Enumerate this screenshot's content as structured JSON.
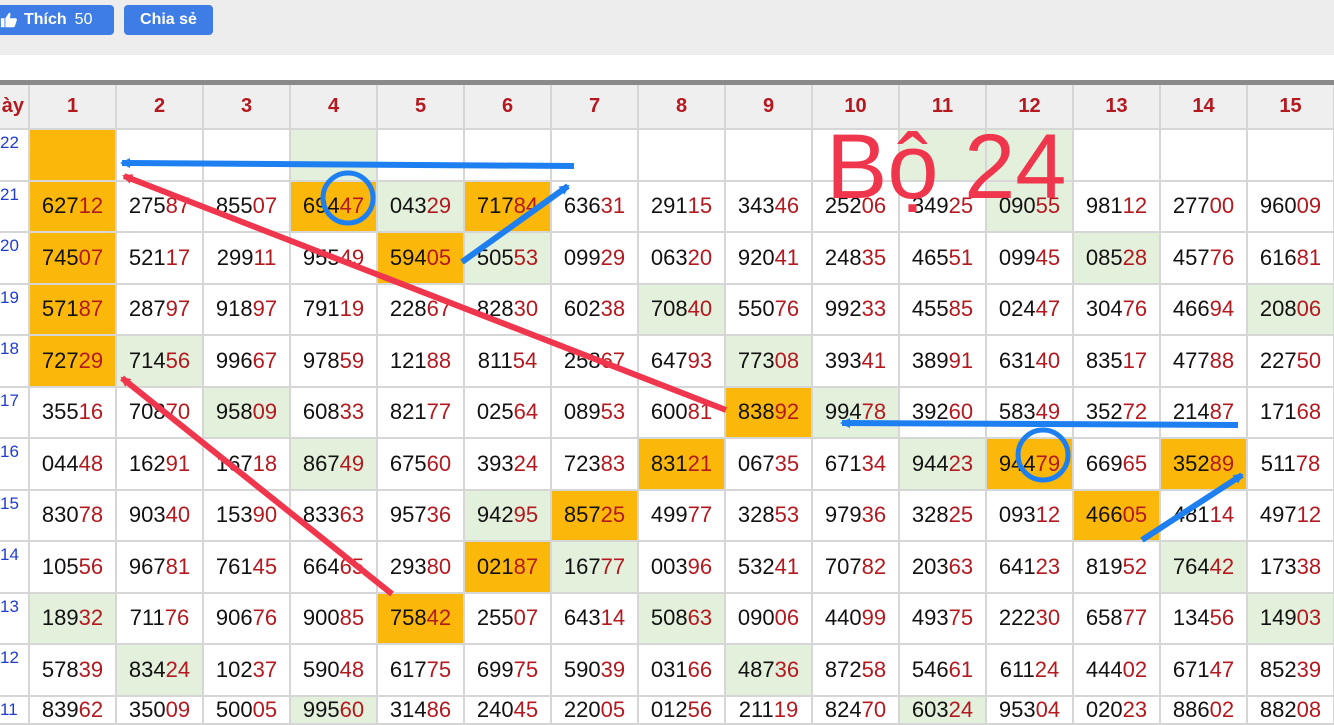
{
  "toolbar": {
    "like_label": "Thích",
    "like_count": "50",
    "share_label": "Chia sẻ"
  },
  "annotation": {
    "text": "Bộ 24"
  },
  "colors": {
    "orange": "#fbb80a",
    "green": "#e3f0dc",
    "red_digits": "#b3191f",
    "arrow_red": "#f0364d",
    "arrow_blue": "#1e7ff0"
  },
  "table": {
    "columns": [
      "ày",
      "1",
      "2",
      "3",
      "4",
      "5",
      "6",
      "7",
      "8",
      "9",
      "10",
      "11",
      "12",
      "13",
      "14",
      "15"
    ],
    "rows": [
      {
        "day": "22",
        "cells": [
          "",
          "",
          "",
          "",
          "",
          "",
          "",
          "",
          "",
          "",
          "",
          "",
          "",
          "",
          ""
        ],
        "hl": [
          "o",
          "",
          "",
          "g",
          "",
          "",
          "",
          "",
          "",
          "",
          "g",
          "g",
          "",
          "",
          ""
        ]
      },
      {
        "day": "21",
        "cells": [
          "62712",
          "27587",
          "85507",
          "69447",
          "04329",
          "71784",
          "63631",
          "29115",
          "34346",
          "25206",
          "34925",
          "09055",
          "98112",
          "27700",
          "96009"
        ],
        "hl": [
          "o",
          "",
          "",
          "o",
          "g",
          "o",
          "",
          "",
          "",
          "",
          "",
          "g",
          "",
          "",
          ""
        ]
      },
      {
        "day": "20",
        "cells": [
          "74507",
          "52117",
          "29911",
          "95549",
          "59405",
          "50553",
          "09929",
          "06320",
          "92041",
          "24835",
          "46551",
          "09945",
          "08528",
          "45776",
          "61681"
        ],
        "hl": [
          "o",
          "",
          "",
          "",
          "o",
          "g",
          "",
          "",
          "",
          "",
          "",
          "",
          "g",
          "",
          ""
        ]
      },
      {
        "day": "19",
        "cells": [
          "57187",
          "28797",
          "91897",
          "79119",
          "22867",
          "82830",
          "60238",
          "70840",
          "55076",
          "99233",
          "45585",
          "02447",
          "30476",
          "46694",
          "20806"
        ],
        "hl": [
          "o",
          "",
          "",
          "",
          "",
          "",
          "",
          "g",
          "",
          "",
          "",
          "",
          "",
          "",
          "g"
        ]
      },
      {
        "day": "18",
        "cells": [
          "72729",
          "71456",
          "99667",
          "97859",
          "12188",
          "81154",
          "25867",
          "64793",
          "77308",
          "39341",
          "38991",
          "63140",
          "83517",
          "47788",
          "22750"
        ],
        "hl": [
          "o",
          "g",
          "",
          "",
          "",
          "",
          "",
          "",
          "g",
          "",
          "",
          "",
          "",
          "",
          ""
        ]
      },
      {
        "day": "17",
        "cells": [
          "35516",
          "70870",
          "95809",
          "60833",
          "82177",
          "02564",
          "08953",
          "60081",
          "83892",
          "99478",
          "39260",
          "58349",
          "35272",
          "21487",
          "17168"
        ],
        "hl": [
          "",
          "",
          "g",
          "",
          "",
          "",
          "",
          "",
          "o",
          "g",
          "",
          "",
          "",
          "",
          ""
        ]
      },
      {
        "day": "16",
        "cells": [
          "04448",
          "16291",
          "16718",
          "86749",
          "67560",
          "39324",
          "72383",
          "83121",
          "06735",
          "67134",
          "94423",
          "94479",
          "66965",
          "35289",
          "51178"
        ],
        "hl": [
          "",
          "",
          "",
          "g",
          "",
          "",
          "",
          "o",
          "",
          "",
          "g",
          "o",
          "",
          "o",
          ""
        ]
      },
      {
        "day": "15",
        "cells": [
          "83078",
          "90340",
          "15390",
          "83363",
          "95736",
          "94295",
          "85725",
          "49977",
          "32853",
          "97936",
          "32825",
          "09312",
          "46605",
          "48114",
          "49712"
        ],
        "hl": [
          "",
          "",
          "",
          "",
          "",
          "g",
          "o",
          "",
          "",
          "",
          "",
          "",
          "o",
          "",
          ""
        ]
      },
      {
        "day": "14",
        "cells": [
          "10556",
          "96781",
          "76145",
          "66465",
          "29380",
          "02187",
          "16777",
          "00396",
          "53241",
          "70782",
          "20363",
          "64123",
          "81952",
          "76442",
          "17338"
        ],
        "hl": [
          "",
          "",
          "",
          "",
          "",
          "o",
          "g",
          "",
          "",
          "",
          "",
          "",
          "",
          "g",
          ""
        ]
      },
      {
        "day": "13",
        "cells": [
          "18932",
          "71176",
          "90676",
          "90085",
          "75842",
          "25507",
          "64314",
          "50863",
          "09006",
          "44099",
          "49375",
          "22230",
          "65877",
          "13456",
          "14903"
        ],
        "hl": [
          "g",
          "",
          "",
          "",
          "o",
          "",
          "",
          "g",
          "",
          "",
          "",
          "",
          "",
          "",
          "g"
        ]
      },
      {
        "day": "12",
        "cells": [
          "57839",
          "83424",
          "10237",
          "59048",
          "61775",
          "69975",
          "59039",
          "03166",
          "48736",
          "87258",
          "54661",
          "61124",
          "44402",
          "67147",
          "85239"
        ],
        "hl": [
          "",
          "g",
          "",
          "",
          "",
          "",
          "",
          "",
          "g",
          "",
          "",
          "",
          "",
          "",
          ""
        ]
      },
      {
        "day": "11",
        "cells": [
          "83962",
          "35009",
          "50005",
          "99560",
          "31486",
          "24045",
          "22005",
          "01256",
          "21119",
          "82470",
          "60324",
          "95304",
          "02023",
          "88602",
          "88208"
        ],
        "hl": [
          "",
          "",
          "",
          "g",
          "",
          "",
          "",
          "",
          "",
          "",
          "g",
          "",
          "",
          "",
          ""
        ]
      }
    ]
  }
}
